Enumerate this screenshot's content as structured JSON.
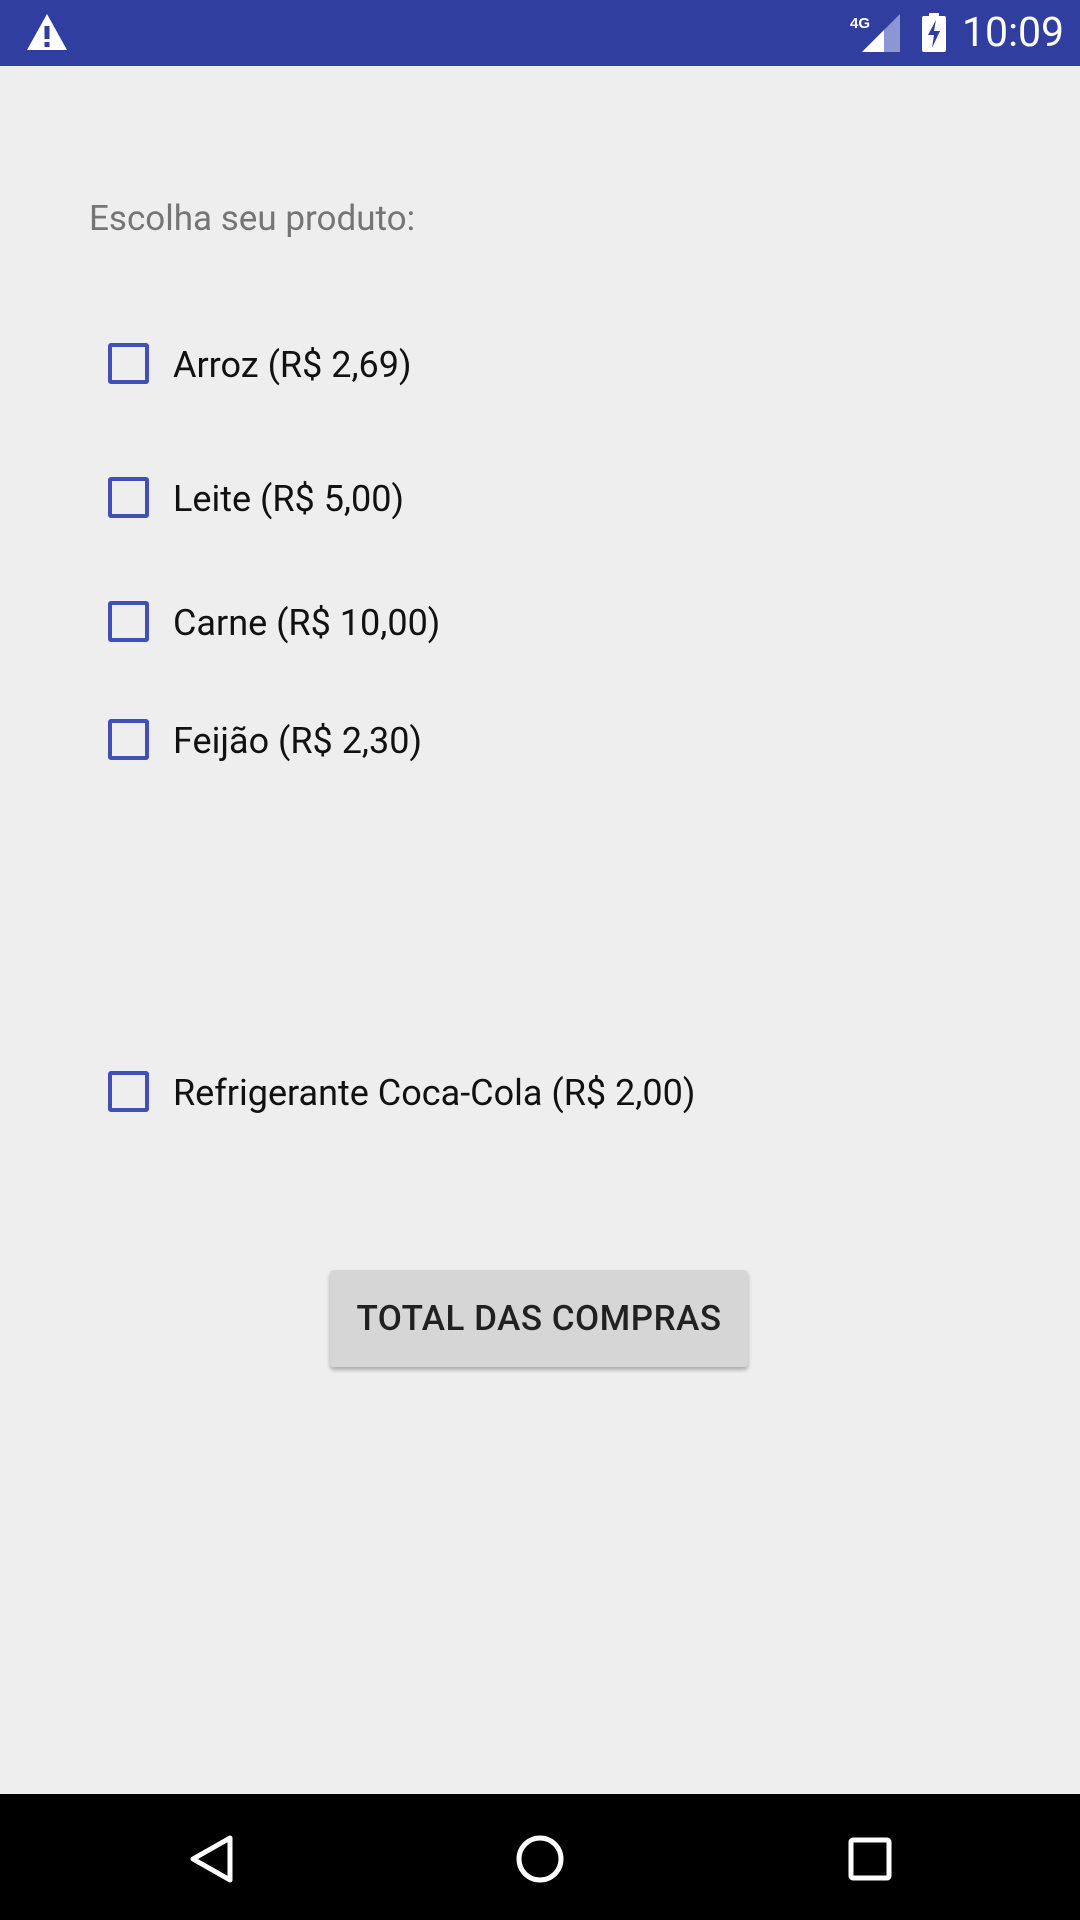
{
  "status_bar": {
    "time": "10:09",
    "network_label": "4G",
    "icons": [
      "warning-icon",
      "network-4g-icon",
      "battery-charging-icon"
    ]
  },
  "main": {
    "prompt": "Escolha seu produto:",
    "products": [
      {
        "label": "Arroz (R$ 2,69)",
        "checked": false
      },
      {
        "label": "Leite (R$ 5,00)",
        "checked": false
      },
      {
        "label": "Carne (R$ 10,00)",
        "checked": false
      },
      {
        "label": "Feijão (R$ 2,30)",
        "checked": false
      },
      {
        "label": "Refrigerante Coca-Cola (R$ 2,00)",
        "checked": false
      }
    ],
    "total_button_label": "TOTAL DAS COMPRAS"
  },
  "nav_bar": {
    "icons": [
      "back-icon",
      "home-icon",
      "recents-icon"
    ]
  },
  "colors": {
    "status_bar": "#303f9f",
    "accent": "#3f51b5",
    "background": "#eeeeee",
    "button": "#d6d6d6"
  }
}
